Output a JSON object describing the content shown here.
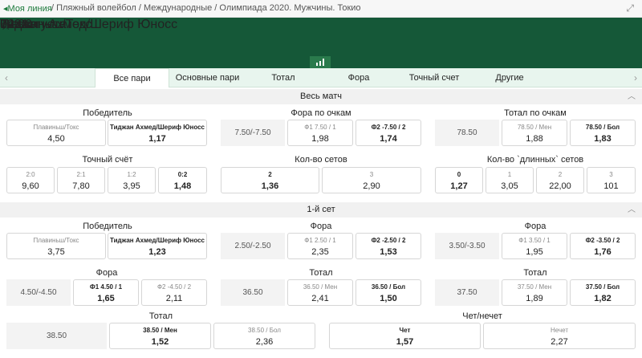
{
  "topbar": {
    "back": "Моя линия",
    "breadcrumb": "/ Пляжный волейбол / Международные / Олимпиада 2020. Мужчины. Токио",
    "expand": "⤢"
  },
  "match": {
    "time": "04:00",
    "date": "7-е августа",
    "id": "3231",
    "team1": "Плавиньш/Токс",
    "team2": "Тиджан Ахмед/Шериф Юносс"
  },
  "tabs": [
    "Все пари",
    "Основные пари",
    "Тотал",
    "Фора",
    "Точный счет",
    "Другие"
  ],
  "sections": {
    "whole": "Весь матч",
    "set1": "1-й сет"
  },
  "g": {
    "winner": {
      "title": "Победитель",
      "a_lbl": "Плавиньш/Токс",
      "a_val": "4,50",
      "b_lbl": "Тиджан Ахмед/Шериф Юносс",
      "b_val": "1,17"
    },
    "hcp": {
      "title": "Фора по очкам",
      "line": "7.50/-7.50",
      "a_lbl": "Ф1 7.50 / 1",
      "a_val": "1,98",
      "b_lbl": "Ф2 -7.50 / 2",
      "b_val": "1,74"
    },
    "total": {
      "title": "Тотал по очкам",
      "line": "78.50",
      "a_lbl": "78.50 / Мен",
      "a_val": "1,88",
      "b_lbl": "78.50 / Бол",
      "b_val": "1,83"
    },
    "exact": {
      "title": "Точный счёт",
      "c1_lbl": "2:0",
      "c1_val": "9,60",
      "c2_lbl": "2:1",
      "c2_val": "7,80",
      "c3_lbl": "1:2",
      "c3_val": "3,95",
      "c4_lbl": "0:2",
      "c4_val": "1,48"
    },
    "sets": {
      "title": "Кол-во сетов",
      "a_lbl": "2",
      "a_val": "1,36",
      "b_lbl": "3",
      "b_val": "2,90"
    },
    "long": {
      "title": "Кол-во `длинных` сетов",
      "c1_lbl": "0",
      "c1_val": "1,27",
      "c2_lbl": "1",
      "c2_val": "3,05",
      "c3_lbl": "2",
      "c3_val": "22,00",
      "c4_lbl": "3",
      "c4_val": "101"
    },
    "s1winner": {
      "title": "Победитель",
      "a_lbl": "Плавиньш/Токс",
      "a_val": "3,75",
      "b_lbl": "Тиджан Ахмед/Шериф Юносс",
      "b_val": "1,23"
    },
    "s1hcp1": {
      "title": "Фора",
      "line": "2.50/-2.50",
      "a_lbl": "Ф1 2.50 / 1",
      "a_val": "2,35",
      "b_lbl": "Ф2 -2.50 / 2",
      "b_val": "1,53"
    },
    "s1hcp2": {
      "title": "Фора",
      "line": "3.50/-3.50",
      "a_lbl": "Ф1 3.50 / 1",
      "a_val": "1,95",
      "b_lbl": "Ф2 -3.50 / 2",
      "b_val": "1,76"
    },
    "s1hcp3": {
      "title": "Фора",
      "line": "4.50/-4.50",
      "a_lbl": "Ф1 4.50 / 1",
      "a_val": "1,65",
      "b_lbl": "Ф2 -4.50 / 2",
      "b_val": "2,11"
    },
    "s1tot1": {
      "title": "Тотал",
      "line": "36.50",
      "a_lbl": "36.50 / Мен",
      "a_val": "2,41",
      "b_lbl": "36.50 / Бол",
      "b_val": "1,50"
    },
    "s1tot2": {
      "title": "Тотал",
      "line": "37.50",
      "a_lbl": "37.50 / Мен",
      "a_val": "1,89",
      "b_lbl": "37.50 / Бол",
      "b_val": "1,82"
    },
    "s1tot3": {
      "title": "Тотал",
      "line": "38.50",
      "a_lbl": "38.50 / Мен",
      "a_val": "1,52",
      "b_lbl": "38.50 / Бол",
      "b_val": "2,36"
    },
    "oddeven": {
      "title": "Чет/нечет",
      "a_lbl": "Чет",
      "a_val": "1,57",
      "b_lbl": "Нечет",
      "b_val": "2,27"
    }
  },
  "colors": {
    "header": "#155838",
    "accent": "#1d7a3c",
    "tabs_bg": "#e8f5ee"
  },
  "icons": {
    "back": "chevron-left-icon",
    "star": "star-icon",
    "stats": "bar-chart-icon",
    "expand": "expand-icon",
    "collapse": "chevron-up-icon"
  }
}
